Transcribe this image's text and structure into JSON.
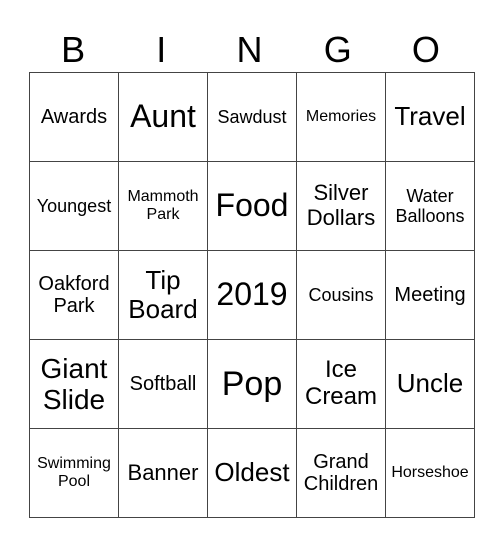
{
  "header": [
    "B",
    "I",
    "N",
    "G",
    "O"
  ],
  "rows": [
    [
      "Awards",
      "Aunt",
      "Sawdust",
      "Memories",
      "Travel"
    ],
    [
      "Youngest",
      "Mammoth Park",
      "Food",
      "Silver Dollars",
      "Water Balloons"
    ],
    [
      "Oakford Park",
      "Tip Board",
      "2019",
      "Cousins",
      "Meeting"
    ],
    [
      "Giant Slide",
      "Softball",
      "Pop",
      "Ice Cream",
      "Uncle"
    ],
    [
      "Swimming Pool",
      "Banner",
      "Oldest",
      "Grand Children",
      "Horseshoe"
    ]
  ],
  "display_rows": [
    [
      "Awards",
      "Aunt",
      "Sawdust",
      "Memories",
      "Travel"
    ],
    [
      "Youngest",
      "Mammoth\nPark",
      "Food",
      "Silver\nDollars",
      "Water\nBalloons"
    ],
    [
      "Oakford\nPark",
      "Tip\nBoard",
      "2019",
      "Cousins",
      "Meeting"
    ],
    [
      "Giant\nSlide",
      "Softball",
      "Pop",
      "Ice\nCream",
      "Uncle"
    ],
    [
      "Swimming\nPool",
      "Banner",
      "Oldest",
      "Grand\nChildren",
      "Horseshoe"
    ]
  ]
}
